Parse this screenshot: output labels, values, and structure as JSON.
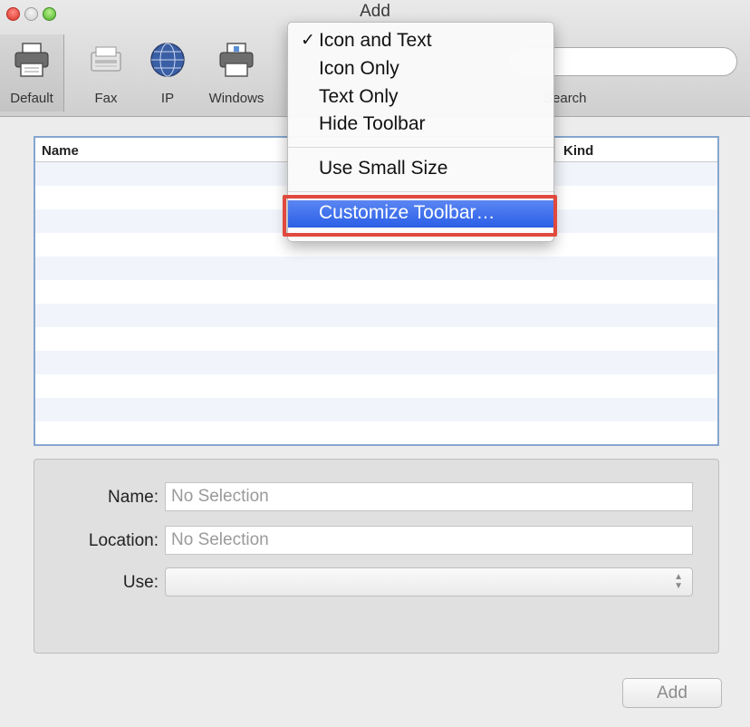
{
  "window": {
    "title": "Add"
  },
  "toolbar": {
    "items": [
      {
        "label": "Default",
        "icon": "printer-icon"
      },
      {
        "label": "Fax",
        "icon": "fax-icon"
      },
      {
        "label": "IP",
        "icon": "globe-icon"
      },
      {
        "label": "Windows",
        "icon": "windows-printer-icon"
      }
    ],
    "search_label": "Search"
  },
  "list": {
    "columns": [
      "Name",
      "Kind"
    ]
  },
  "context_menu": {
    "items": [
      {
        "label": "Icon and Text",
        "checked": true
      },
      {
        "label": "Icon Only"
      },
      {
        "label": "Text Only"
      },
      {
        "label": "Hide Toolbar"
      },
      {
        "label": "Use Small Size"
      },
      {
        "label": "Customize Toolbar…",
        "highlighted": true
      }
    ],
    "check_glyph": "✓"
  },
  "form": {
    "name_label": "Name:",
    "name_placeholder": "No Selection",
    "location_label": "Location:",
    "location_placeholder": "No Selection",
    "use_label": "Use:",
    "use_value": ""
  },
  "buttons": {
    "add_label": "Add"
  },
  "colors": {
    "highlight": "#2a5fe6",
    "annotation": "#e0493d",
    "list_border": "#86a6cf"
  }
}
